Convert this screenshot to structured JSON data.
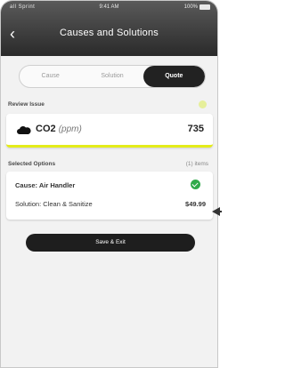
{
  "status_bar": {
    "carrier": "all Sprint",
    "time": "9:41 AM",
    "battery": "100%"
  },
  "nav": {
    "back_icon": "chevron-left-icon",
    "title": "Causes and Solutions"
  },
  "tabs": [
    {
      "label": "Cause",
      "active": false
    },
    {
      "label": "Solution",
      "active": false
    },
    {
      "label": "Quote",
      "active": true
    }
  ],
  "review": {
    "label": "Review Issue",
    "issue_icon": "cloud-icon",
    "issue_name": "CO2",
    "issue_unit": "(ppm)",
    "issue_value": "735",
    "accent_color": "#e4ec1a"
  },
  "options": {
    "label": "Selected Options",
    "count": "(1) items",
    "cause": "Cause: Air Handler",
    "solution": "Solution: Clean & Sanitize",
    "price": "$49.99",
    "check_color": "#2faa4a"
  },
  "actions": {
    "save_label": "Save & Exit"
  }
}
